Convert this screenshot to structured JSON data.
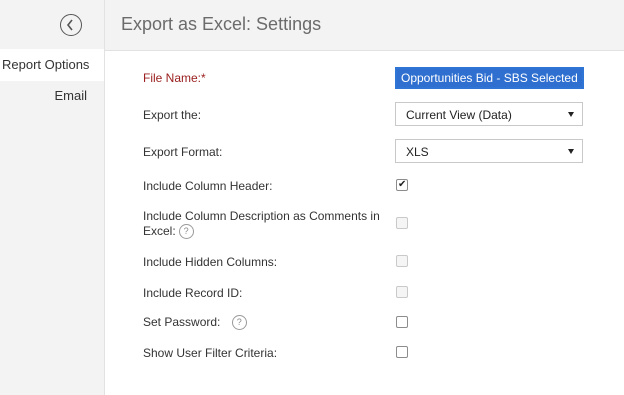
{
  "sidebar": {
    "back_icon": "back-arrow-circle-icon",
    "items": [
      {
        "label": "Report Options",
        "active": true
      },
      {
        "label": "Email",
        "active": false
      }
    ]
  },
  "header": {
    "title": "Export as Excel: Settings"
  },
  "form": {
    "file_name": {
      "label": "File Name:*",
      "value": "Opportunities Bid - SBS Selected"
    },
    "export_the": {
      "label": "Export the:",
      "value": "Current View (Data)"
    },
    "export_format": {
      "label": "Export Format:",
      "value": "XLS"
    },
    "include_column_header": {
      "label": "Include Column Header:",
      "checked": true,
      "disabled": false
    },
    "include_column_description": {
      "label_line1": "Include Column Description as Comments in",
      "label_line2": "Excel:",
      "help": "?",
      "checked": false,
      "disabled": true
    },
    "include_hidden_columns": {
      "label": "Include Hidden Columns:",
      "checked": false,
      "disabled": true
    },
    "include_record_id": {
      "label": "Include Record ID:",
      "checked": false,
      "disabled": true
    },
    "set_password": {
      "label": "Set Password:",
      "help": "?",
      "checked": false,
      "disabled": false
    },
    "show_user_filter": {
      "label": "Show User Filter Criteria:",
      "checked": false,
      "disabled": false
    }
  },
  "colors": {
    "required_label": "#9b2020",
    "selection": "#2f6fd0",
    "sidebar_bg": "#f3f3f3"
  }
}
